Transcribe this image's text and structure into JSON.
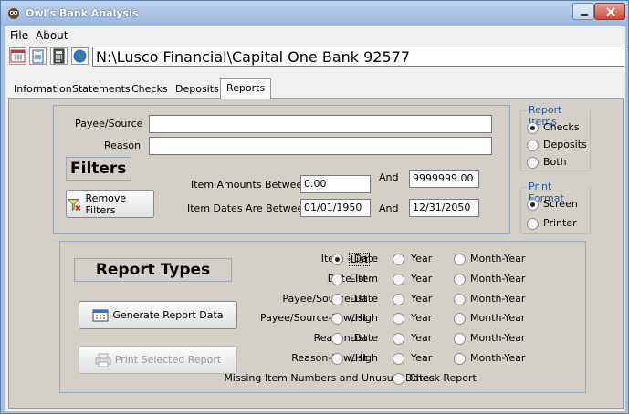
{
  "window": {
    "title": "Owl's Bank Analysis"
  },
  "menu": {
    "file": "File",
    "about": "About"
  },
  "toolbar": {
    "path": "N:\\Lusco Financial\\Capital One Bank 92577"
  },
  "tabs": [
    "Information",
    "Statements",
    "Checks",
    "Deposits",
    "Reports"
  ],
  "filters": {
    "payee_label": "Payee/Source",
    "payee_value": "",
    "reason_label": "Reason",
    "reason_value": "",
    "title": "Filters",
    "amounts_label": "Item Amounts Between",
    "amount_from": "0.00",
    "and1": "And",
    "amount_to": "9999999.00",
    "dates_label": "Item Dates Are Between",
    "date_from": "01/01/1950",
    "and2": "And",
    "date_to": "12/31/2050",
    "remove_button": "Remove Filters"
  },
  "report_items": {
    "title": "Report Items",
    "options": [
      "Checks",
      "Deposits",
      "Both"
    ],
    "selected": "Checks"
  },
  "print_format": {
    "title": "Print Format",
    "options": [
      "Screen",
      "Printer"
    ],
    "selected": "Screen"
  },
  "report_types": {
    "title": "Report Types",
    "generate_button": "Generate Report Data",
    "print_button": "Print Selected Report",
    "rows": [
      {
        "label": "Item - Date",
        "list": "List",
        "year": "Year",
        "month": "Month-Year"
      },
      {
        "label": "Date-Item",
        "list": "List",
        "year": "Year",
        "month": "Month-Year"
      },
      {
        "label": "Payee/Source-Date",
        "list": "List",
        "year": "Year",
        "month": "Month-Year"
      },
      {
        "label": "Payee/Source-Low/High",
        "list": "List",
        "year": "Year",
        "month": "Month-Year"
      },
      {
        "label": "Reason-Date",
        "list": "List",
        "year": "Year",
        "month": "Month-Year"
      },
      {
        "label": "Reason-Low/High",
        "list": "List",
        "year": "Year",
        "month": "Month-Year"
      }
    ],
    "missing_label": "Missing Item Numbers and Unusual Dates",
    "check_report": "Check Report"
  }
}
